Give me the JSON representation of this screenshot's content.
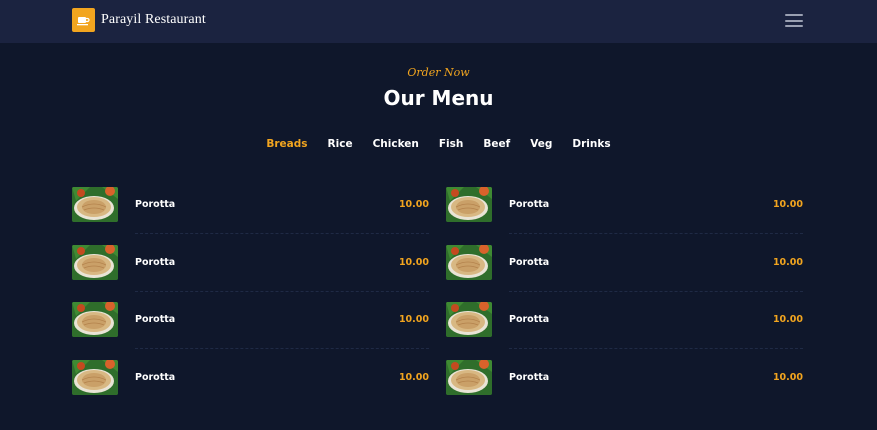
{
  "navbar": {
    "brand_name": "Parayil Restaurant",
    "brand_icon": "restaurant-icon",
    "menu_icon": "hamburger-icon",
    "brand_color": "#f2a51f"
  },
  "section": {
    "kicker": "Order Now",
    "title": "Our Menu"
  },
  "tabs": [
    {
      "label": "Breads",
      "active": true
    },
    {
      "label": "Rice",
      "active": false
    },
    {
      "label": "Chicken",
      "active": false
    },
    {
      "label": "Fish",
      "active": false
    },
    {
      "label": "Beef",
      "active": false
    },
    {
      "label": "Veg",
      "active": false
    },
    {
      "label": "Drinks",
      "active": false
    }
  ],
  "menu": {
    "left": [
      {
        "name": "Porotta",
        "price": "10.00"
      },
      {
        "name": "Porotta",
        "price": "10.00"
      },
      {
        "name": "Porotta",
        "price": "10.00"
      },
      {
        "name": "Porotta",
        "price": "10.00"
      }
    ],
    "right": [
      {
        "name": "Porotta",
        "price": "10.00"
      },
      {
        "name": "Porotta",
        "price": "10.00"
      },
      {
        "name": "Porotta",
        "price": "10.00"
      },
      {
        "name": "Porotta",
        "price": "10.00"
      }
    ]
  },
  "colors": {
    "background": "#0f172b",
    "navbar": "#1b2340",
    "accent": "#f2a51f"
  }
}
